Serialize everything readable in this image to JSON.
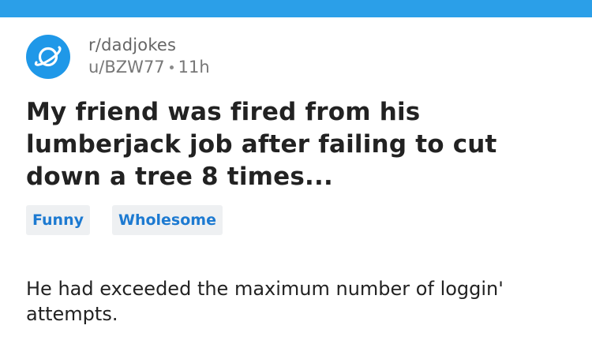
{
  "header": {
    "bar_color": "#2b9fe8"
  },
  "post": {
    "avatar_icon": "planet-icon",
    "subreddit": "r/dadjokes",
    "author": "u/BZW77",
    "separator": "•",
    "age": "11h",
    "title": "My friend was fired from his lumberjack job after failing to cut down a tree 8 times...",
    "flairs": [
      "Funny",
      "Wholesome"
    ],
    "body": "He had exceeded the maximum number of loggin' attempts."
  },
  "colors": {
    "accent": "#1f98e8",
    "flair_text": "#1d7ad1",
    "flair_bg": "#eef0f2"
  }
}
